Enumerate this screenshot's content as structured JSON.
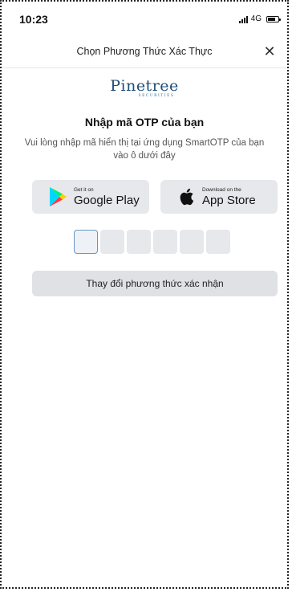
{
  "status_bar": {
    "time": "10:23",
    "network": "4G"
  },
  "header": {
    "title": "Chọn Phương Thức Xác Thực",
    "close_glyph": "✕"
  },
  "brand": {
    "name": "Pinetree",
    "sub": "SECURITIES"
  },
  "otp": {
    "title": "Nhập mã OTP của bạn",
    "description": "Vui lòng nhập mã hiển thị tại ứng dụng SmartOTP của bạn vào ô dưới đây",
    "box_count": 6
  },
  "stores": {
    "google": {
      "small_label": "Get it on",
      "big_label": "Google Play",
      "icon": "google-play-icon"
    },
    "apple": {
      "small_label": "Download on the",
      "big_label": "App Store",
      "icon": "apple-icon"
    }
  },
  "actions": {
    "change_method_label": "Thay đổi phương thức xác nhận"
  }
}
